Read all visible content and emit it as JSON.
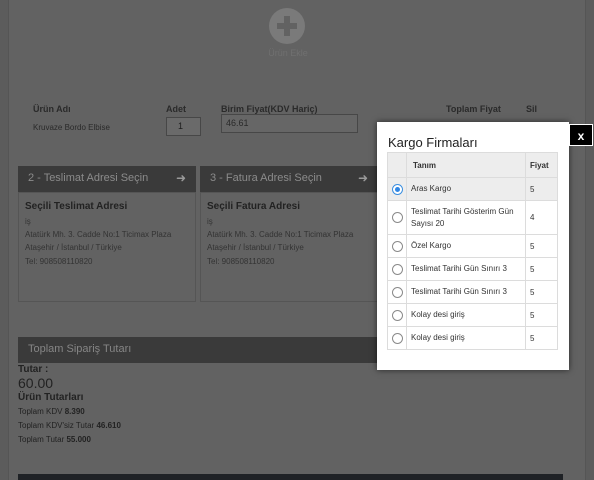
{
  "add_product": {
    "label": "Ürün Ekle",
    "icon": "plus-circle-icon"
  },
  "product_table": {
    "headers": {
      "name": "Ürün Adı",
      "qty": "Adet",
      "unit_price": "Birim Fiyat(KDV Hariç)",
      "total": "Toplam Fiyat",
      "delete": "Sil"
    },
    "row": {
      "name": "Kruvaze Bordo Elbise",
      "qty": "1",
      "unit_price": "46.61"
    }
  },
  "shipping": {
    "bar_label": "2 - Teslimat Adresi Seçin",
    "title": "Seçili Teslimat Adresi",
    "lines": [
      "iş",
      "Atatürk Mh. 3. Cadde No:1 Ticimax Plaza",
      "Ataşehir / İstanbul / Türkiye",
      "Tel: 908508110820"
    ]
  },
  "billing": {
    "bar_label": "3 - Fatura Adresi Seçin",
    "title": "Seçili Fatura Adresi",
    "lines": [
      "iş",
      "Atatürk Mh. 3. Cadde No:1 Ticimax Plaza",
      "Ataşehir / İstanbul / Türkiye",
      "Tel: 908508110820"
    ]
  },
  "totals": {
    "bar_label": "Toplam Sipariş Tutarı",
    "amount_label": "Tutar :",
    "amount": "60.00",
    "section_title": "Ürün Tutarları",
    "kdv_label": "Toplam KDV",
    "kdv_value": "8.390",
    "excl_label": "Toplam KDV'siz Tutar",
    "excl_value": "46.610",
    "total_label": "Toplam Tutar",
    "total_value": "55.000"
  },
  "modal": {
    "title": "Kargo Firmaları",
    "close_label": "x",
    "headers": {
      "name": "Tanım",
      "price": "Fiyat"
    },
    "rows": [
      {
        "name": "Aras Kargo",
        "price": "5",
        "selected": true
      },
      {
        "name": "Teslimat Tarihi Gösterim Gün Sayısı 20",
        "price": "4",
        "selected": false
      },
      {
        "name": "Özel Kargo",
        "price": "5",
        "selected": false
      },
      {
        "name": "Teslimat Tarihi Gün Sınırı 3",
        "price": "5",
        "selected": false
      },
      {
        "name": "Teslimat Tarihi Gün Sınırı 3",
        "price": "5",
        "selected": false
      },
      {
        "name": "Kolay desi giriş",
        "price": "5",
        "selected": false
      },
      {
        "name": "Kolay desi giriş",
        "price": "5",
        "selected": false
      }
    ]
  },
  "colors": {
    "overlay": "#5c5c5c",
    "radio_selected": "#2f86e4",
    "close_bg": "#000000"
  }
}
